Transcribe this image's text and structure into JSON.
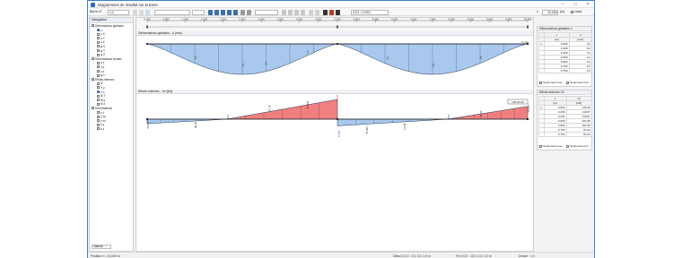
{
  "window": {
    "title": "Diagrammes de résultat sur la barre"
  },
  "toolbar": {
    "member_label": "Barre n°:",
    "member_value": "1,2",
    "result_combo": "CO1 / COS1",
    "x_value": "10.000",
    "x_unit": "[m]",
    "smooth_label": "Lissé"
  },
  "navigator": {
    "title": "Navigateur",
    "items": [
      {
        "label": "Déformations globales",
        "level": 0,
        "checked": true
      },
      {
        "label": "u",
        "level": 1,
        "checked": true
      },
      {
        "label": "u X",
        "level": 1,
        "checked": false
      },
      {
        "label": "u Y",
        "level": 1,
        "checked": false
      },
      {
        "label": "u Z",
        "level": 1,
        "checked": false
      },
      {
        "label": "φ X",
        "level": 1,
        "checked": false
      },
      {
        "label": "φ Y",
        "level": 1,
        "checked": false
      },
      {
        "label": "φ Z",
        "level": 1,
        "checked": false
      },
      {
        "label": "Déformations locales",
        "level": 0,
        "checked": false
      },
      {
        "label": "u x",
        "level": 1,
        "checked": false
      },
      {
        "label": "u y",
        "level": 1,
        "checked": false
      },
      {
        "label": "u z",
        "level": 1,
        "checked": false
      },
      {
        "label": "φ x",
        "level": 1,
        "checked": false
      },
      {
        "label": "Efforts internes",
        "level": 0,
        "checked": true
      },
      {
        "label": "N",
        "level": 1,
        "checked": false
      },
      {
        "label": "V y",
        "level": 1,
        "checked": false
      },
      {
        "label": "V z",
        "level": 1,
        "checked": true
      },
      {
        "label": "M T",
        "level": 1,
        "checked": false
      },
      {
        "label": "M y",
        "level": 1,
        "checked": false
      },
      {
        "label": "M z",
        "level": 1,
        "checked": false
      },
      {
        "label": "Déformations",
        "level": 0,
        "checked": false
      },
      {
        "label": "ε x",
        "level": 1,
        "checked": false
      },
      {
        "label": "γ xy",
        "level": 1,
        "checked": false
      },
      {
        "label": "γ xz",
        "level": 1,
        "checked": false
      },
      {
        "label": "κ y",
        "level": 1,
        "checked": false
      },
      {
        "label": "κ z",
        "level": 1,
        "checked": false
      }
    ],
    "footer_button": "Valeurs"
  },
  "ruler": {
    "ticks": [
      "0.000",
      "0.500",
      "1.000",
      "1.500",
      "2.000",
      "2.500",
      "3.000",
      "3.500",
      "4.000",
      "4.500",
      "5.000",
      "5.500",
      "6.000",
      "6.500",
      "7.000",
      "7.500",
      "8.000",
      "8.500",
      "9.000",
      "9.500",
      "10.000"
    ],
    "unit": "m"
  },
  "deform_panel": {
    "title": "Déformations globales - u [mm]",
    "end_label": "0 mm"
  },
  "force_panel": {
    "title": "Efforts internes - Vz [kN]",
    "end_label": "136.20 kN"
  },
  "deform_table": {
    "title": "Déformations globales u",
    "col_x": "x",
    "col_x_unit": "[m]",
    "col_v": "u",
    "col_v_unit": "[mm]",
    "rows": [
      [
        "0.000",
        "0.0"
      ],
      [
        "0.250",
        "0.2"
      ],
      [
        "0.250",
        "0.2"
      ],
      [
        "0.500",
        "0.4"
      ],
      [
        "0.500",
        "0.4"
      ],
      [
        "0.750",
        "0.5"
      ],
      [
        "0.750",
        "0.5"
      ]
    ],
    "cb_max": "Seulement max",
    "cb_min": "Seulement min"
  },
  "force_table": {
    "title": "Efforts internes Vz",
    "col_x": "x",
    "col_x_unit": "[m]",
    "col_v": "Vz",
    "col_v_unit": "[kN]",
    "rows": [
      [
        "0.000",
        "136.20"
      ],
      [
        "0.250",
        "119.87"
      ],
      [
        "0.250",
        "119.87"
      ],
      [
        "0.500",
        "101.60"
      ],
      [
        "0.500",
        "101.60"
      ],
      [
        "0.750",
        "83.23"
      ],
      [
        "0.750",
        "83.23"
      ]
    ],
    "cb_max": "Seulement max",
    "cb_min": "Seulement min"
  },
  "status": {
    "left": "Position x = 10.000 m",
    "s1": "Début 0.0.0 : 0.0, 0.0, 0.0 m",
    "s2": "Fin 0.0.0 : 10.0, 0.0, 0.0 m",
    "s3": "Diviser : 1.0"
  },
  "colors": {
    "positive_fill": "#f08080",
    "negative_fill": "#a9c8ee",
    "outline": "#20364f",
    "member_line": "#202020",
    "accent": "#2b6cc4"
  },
  "chart_data": [
    {
      "type": "area",
      "title": "Déformations globales - u [mm]",
      "x": [
        0.0,
        1.25,
        2.5,
        3.75,
        5.0,
        6.25,
        7.5,
        8.75,
        10.0
      ],
      "series": [
        {
          "name": "u",
          "values": [
            0.0,
            3.6,
            5.2,
            3.6,
            0.0,
            3.6,
            5.2,
            3.6,
            0.0
          ]
        }
      ],
      "data_labels": [
        {
          "x": 1.25,
          "text": "3.6"
        },
        {
          "x": 2.5,
          "text": "5.2"
        },
        {
          "x": 3.1,
          "text": "4.6"
        },
        {
          "x": 4.2,
          "text": "2.1"
        },
        {
          "x": 6.3,
          "text": "3.6"
        },
        {
          "x": 7.5,
          "text": "5.2"
        },
        {
          "x": 8.75,
          "text": "3.6"
        }
      ]
    },
    {
      "type": "area",
      "title": "Efforts internes - Vz [kN]",
      "x": [
        0.0,
        2.1,
        5.0,
        5.0,
        7.9,
        10.0
      ],
      "series": [
        {
          "name": "Vz",
          "values": [
            -136.2,
            0.0,
            210.3,
            -204.4,
            0.0,
            136.2
          ]
        }
      ],
      "data_labels": [
        {
          "x": 0.0,
          "text": "-136.20"
        },
        {
          "x": 1.25,
          "text": "-66.58"
        },
        {
          "x": 2.1,
          "text": "0.00"
        },
        {
          "x": 3.2,
          "text": "82.12"
        },
        {
          "x": 4.2,
          "text": "158.19"
        },
        {
          "x": 5.0,
          "text": "210.3"
        },
        {
          "x": 5.0,
          "text": "-204.4"
        },
        {
          "x": 5.75,
          "text": "-135.42"
        },
        {
          "x": 6.75,
          "text": "-82.13"
        },
        {
          "x": 7.9,
          "text": "0.00"
        },
        {
          "x": 8.75,
          "text": "66.58"
        },
        {
          "x": 10.0,
          "text": "136.20"
        }
      ]
    }
  ]
}
